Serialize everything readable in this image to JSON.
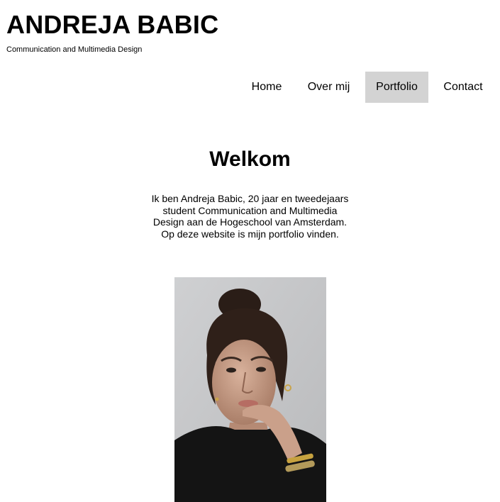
{
  "header": {
    "title": "ANDREJA BABIC",
    "subtitle": "Communication and Multimedia Design"
  },
  "nav": {
    "items": [
      {
        "label": "Home"
      },
      {
        "label": "Over mij"
      },
      {
        "label": "Portfolio",
        "active": true
      },
      {
        "label": "Contact"
      }
    ]
  },
  "main": {
    "heading": "Welkom",
    "intro": "Ik ben Andreja Babic, 20 jaar en tweedejaars student Communication and Multimedia Design aan de Hogeschool van Amsterdam. Op deze website is mijn portfolio vinden."
  },
  "colors": {
    "background": "#ffffff",
    "text": "#000000",
    "nav_active_background": "#d3d3d3"
  }
}
